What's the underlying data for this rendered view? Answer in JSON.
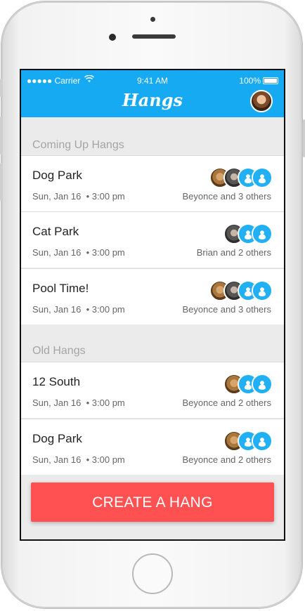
{
  "status_bar": {
    "signal": "●●●●● Carrier",
    "wifi": "wifi-icon",
    "time": "9:41 AM",
    "battery": "100%"
  },
  "header": {
    "title": "Hangs",
    "profile_avatar": "profile-avatar-icon",
    "background_color": "#16aaf2"
  },
  "sections": {
    "upcoming_title": "Coming Up Hangs",
    "old_title": "Old Hangs"
  },
  "upcoming_hangs": [
    {
      "name": "Dog Park",
      "date": "Sun, Jan 16",
      "time": "3:00 pm",
      "people": "Beyonce and 3 others"
    },
    {
      "name": "Cat Park",
      "date": "Sun, Jan 16",
      "time": "3:00 pm",
      "people": "Brian and 2 others"
    },
    {
      "name": "Pool Time!",
      "date": "Sun, Jan 16",
      "time": "3:00 pm",
      "people": "Beyonce and 3 others"
    }
  ],
  "old_hangs": [
    {
      "name": "12 South",
      "date": "Sun, Jan 16",
      "time": "3:00 pm",
      "people": "Beyonce and 2 others"
    },
    {
      "name": "Dog Park",
      "date": "Sun, Jan 16",
      "time": "3:00 pm",
      "people": "Beyonce and 2 others"
    }
  ],
  "cta": {
    "label": "CREATE A HANG",
    "color": "#ff5151"
  }
}
